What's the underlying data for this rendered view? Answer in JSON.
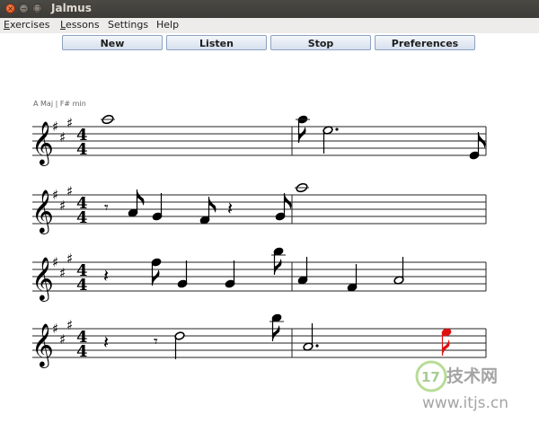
{
  "window": {
    "title": "Jalmus",
    "controls": {
      "close": "×",
      "minimize": "−",
      "maximize": "□"
    }
  },
  "menu": [
    {
      "label": "Exercises",
      "mnemonic": "E",
      "rest": "xercises"
    },
    {
      "label": "Lessons",
      "mnemonic": "L",
      "rest": "essons"
    },
    {
      "label": "Settings",
      "mnemonic": "",
      "rest": "Settings"
    },
    {
      "label": "Help",
      "mnemonic": "",
      "rest": "Help"
    }
  ],
  "toolbar": {
    "new_label": "New",
    "listen_label": "Listen",
    "stop_label": "Stop",
    "preferences_label": "Preferences"
  },
  "score": {
    "key_label": "A Maj | F# min",
    "clef": "treble",
    "key_signature": "F# C# G#",
    "time_signature": {
      "numerator": "4",
      "denominator": "4"
    },
    "highlight_color": "#dd1111",
    "note_color": "#000000",
    "systems": [
      {
        "bars": [
          [
            {
              "kind": "note",
              "pitch": "A5",
              "duration": "whole"
            }
          ],
          [
            {
              "kind": "note",
              "pitch": "A5",
              "duration": "eighth"
            },
            {
              "kind": "note",
              "pitch": "E5",
              "duration": "dotted-half"
            },
            {
              "kind": "note",
              "pitch": "E4",
              "duration": "eighth"
            }
          ]
        ]
      },
      {
        "bars": [
          [
            {
              "kind": "rest",
              "duration": "eighth"
            },
            {
              "kind": "note",
              "pitch": "A4",
              "duration": "eighth"
            },
            {
              "kind": "note",
              "pitch": "G4",
              "duration": "quarter"
            },
            {
              "kind": "note",
              "pitch": "F4",
              "duration": "eighth"
            },
            {
              "kind": "rest",
              "duration": "quarter"
            },
            {
              "kind": "note",
              "pitch": "G4",
              "duration": "eighth"
            }
          ],
          [
            {
              "kind": "note",
              "pitch": "A5",
              "duration": "whole"
            }
          ]
        ]
      },
      {
        "bars": [
          [
            {
              "kind": "rest",
              "duration": "quarter"
            },
            {
              "kind": "note",
              "pitch": "F5",
              "duration": "eighth"
            },
            {
              "kind": "note",
              "pitch": "G4",
              "duration": "quarter"
            },
            {
              "kind": "note",
              "pitch": "G4",
              "duration": "quarter"
            },
            {
              "kind": "note",
              "pitch": "B5",
              "duration": "eighth"
            }
          ],
          [
            {
              "kind": "note",
              "pitch": "A4",
              "duration": "quarter"
            },
            {
              "kind": "note",
              "pitch": "F4",
              "duration": "quarter"
            },
            {
              "kind": "note",
              "pitch": "A4",
              "duration": "half"
            }
          ]
        ]
      },
      {
        "bars": [
          [
            {
              "kind": "rest",
              "duration": "quarter"
            },
            {
              "kind": "rest",
              "duration": "eighth"
            },
            {
              "kind": "note",
              "pitch": "D5",
              "duration": "half"
            },
            {
              "kind": "note",
              "pitch": "B5",
              "duration": "eighth"
            }
          ],
          [
            {
              "kind": "note",
              "pitch": "A4",
              "duration": "dotted-half"
            },
            {
              "kind": "note",
              "pitch": "E5",
              "duration": "eighth",
              "current": true
            }
          ]
        ]
      }
    ]
  },
  "watermark": {
    "brand": "17技术网",
    "url": "www.itjs.cn"
  }
}
